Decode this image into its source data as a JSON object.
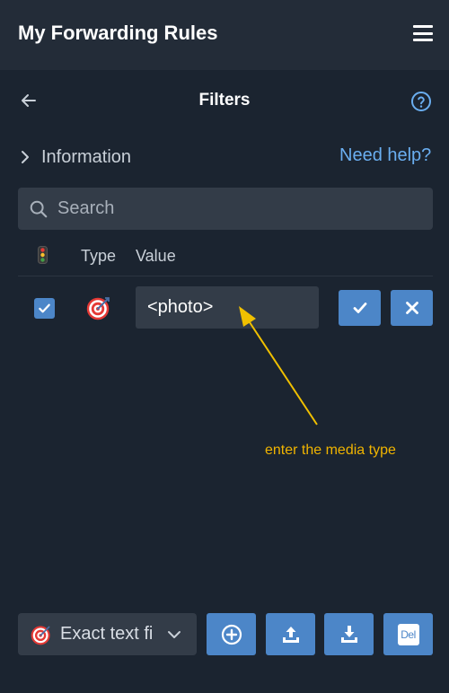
{
  "app": {
    "title": "My Forwarding Rules"
  },
  "page": {
    "title": "Filters"
  },
  "info": {
    "label": "Information",
    "help_link": "Need help?"
  },
  "search": {
    "placeholder": "Search",
    "value": ""
  },
  "table": {
    "columns": {
      "status_icon": "traffic-light-icon",
      "type": "Type",
      "value": "Value"
    },
    "rows": [
      {
        "enabled": true,
        "type_icon": "target-icon",
        "value": "<photo>"
      }
    ]
  },
  "annotation": {
    "text": "enter the media type",
    "color": "#f0b400"
  },
  "footer": {
    "filter_type": "Exact text fi",
    "add_label": "add",
    "upload_label": "upload",
    "download_label": "download",
    "delete_label": "Del"
  },
  "colors": {
    "background": "#1b2430",
    "topbar": "#232c38",
    "field": "#333c48",
    "accent": "#4c86c8",
    "link": "#6aaef0"
  }
}
